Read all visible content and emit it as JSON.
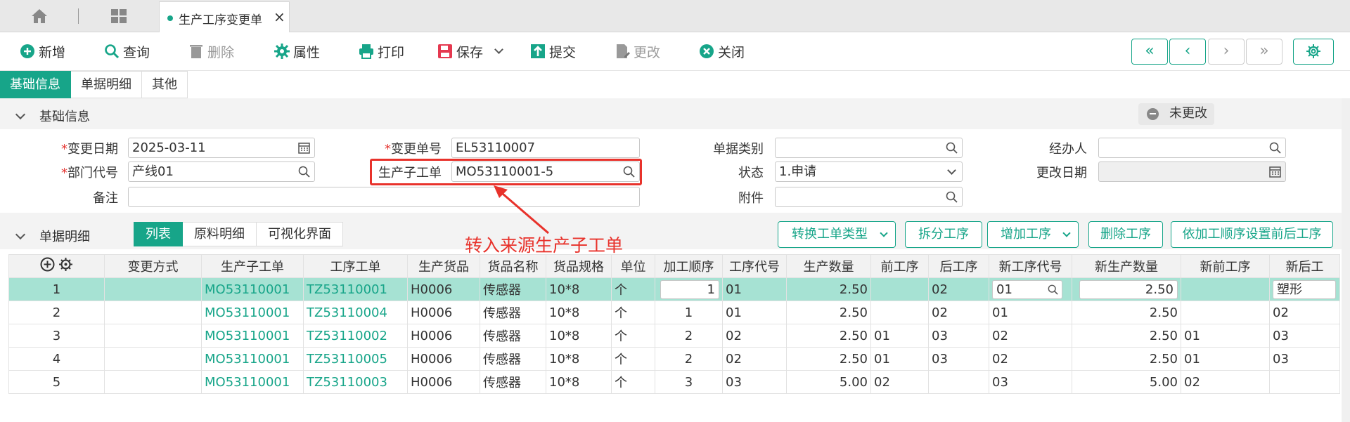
{
  "tab": {
    "title": "生产工序变更单"
  },
  "toolbar": {
    "new": "新增",
    "query": "查询",
    "delete": "删除",
    "props": "属性",
    "print": "打印",
    "save": "保存",
    "submit": "提交",
    "modify": "更改",
    "close": "关闭"
  },
  "subtabs": [
    "基础信息",
    "单据明细",
    "其他"
  ],
  "basic": {
    "title": "基础信息",
    "status_pill": "未更改",
    "labels": {
      "change_date": "变更日期",
      "change_no": "变更单号",
      "doc_type": "单据类别",
      "handler": "经办人",
      "dept": "部门代号",
      "sub_order": "生产子工单",
      "status": "状态",
      "modify_date": "更改日期",
      "remark": "备注",
      "attachment": "附件"
    },
    "values": {
      "change_date": "2025-03-11",
      "change_no": "EL53110007",
      "doc_type": "",
      "handler": "",
      "dept": "产线01",
      "sub_order": "MO53110001-5",
      "status": "1.申请",
      "modify_date": "",
      "remark": "",
      "attachment": ""
    }
  },
  "detail": {
    "title": "单据明细",
    "views": [
      "列表",
      "原料明细",
      "可视化界面"
    ],
    "actions": [
      "转换工单类型",
      "拆分工序",
      "增加工序",
      "删除工序",
      "依加工顺序设置前后工序"
    ]
  },
  "annotation": "转入来源生产子工单",
  "table": {
    "headers": [
      "变更方式",
      "生产子工单",
      "工序工单",
      "生产货品",
      "货品名称",
      "货品规格",
      "单位",
      "加工顺序",
      "工序代号",
      "生产数量",
      "前工序",
      "后工序",
      "新工序代号",
      "新生产数量",
      "新前工序",
      "新后工"
    ],
    "rows": [
      {
        "n": "1",
        "mode": "",
        "mo": "MO53110001",
        "tz": "TZ53110001",
        "item": "H0006",
        "name": "传感器",
        "spec": "10*8",
        "unit": "个",
        "seq": "1",
        "op": "01",
        "qty": "2.50",
        "prev": "",
        "next": "02",
        "nop": "01",
        "nqty": "2.50",
        "nprev": "",
        "nnext": "塑形"
      },
      {
        "n": "2",
        "mode": "",
        "mo": "MO53110001",
        "tz": "TZ53110004",
        "item": "H0006",
        "name": "传感器",
        "spec": "10*8",
        "unit": "个",
        "seq": "1",
        "op": "01",
        "qty": "2.50",
        "prev": "",
        "next": "02",
        "nop": "01",
        "nqty": "2.50",
        "nprev": "",
        "nnext": "02"
      },
      {
        "n": "3",
        "mode": "",
        "mo": "MO53110001",
        "tz": "TZ53110002",
        "item": "H0006",
        "name": "传感器",
        "spec": "10*8",
        "unit": "个",
        "seq": "2",
        "op": "02",
        "qty": "2.50",
        "prev": "01",
        "next": "03",
        "nop": "02",
        "nqty": "2.50",
        "nprev": "01",
        "nnext": "03"
      },
      {
        "n": "4",
        "mode": "",
        "mo": "MO53110001",
        "tz": "TZ53110005",
        "item": "H0006",
        "name": "传感器",
        "spec": "10*8",
        "unit": "个",
        "seq": "2",
        "op": "02",
        "qty": "2.50",
        "prev": "01",
        "next": "03",
        "nop": "02",
        "nqty": "2.50",
        "nprev": "01",
        "nnext": "03"
      },
      {
        "n": "5",
        "mode": "",
        "mo": "MO53110001",
        "tz": "TZ53110003",
        "item": "H0006",
        "name": "传感器",
        "spec": "10*8",
        "unit": "个",
        "seq": "3",
        "op": "03",
        "qty": "5.00",
        "prev": "02",
        "next": "",
        "nop": "03",
        "nqty": "5.00",
        "nprev": "02",
        "nnext": ""
      }
    ]
  },
  "colors": {
    "accent": "#17a589",
    "selected_row": "#a6e2d3",
    "annotation": "#e8322b"
  }
}
